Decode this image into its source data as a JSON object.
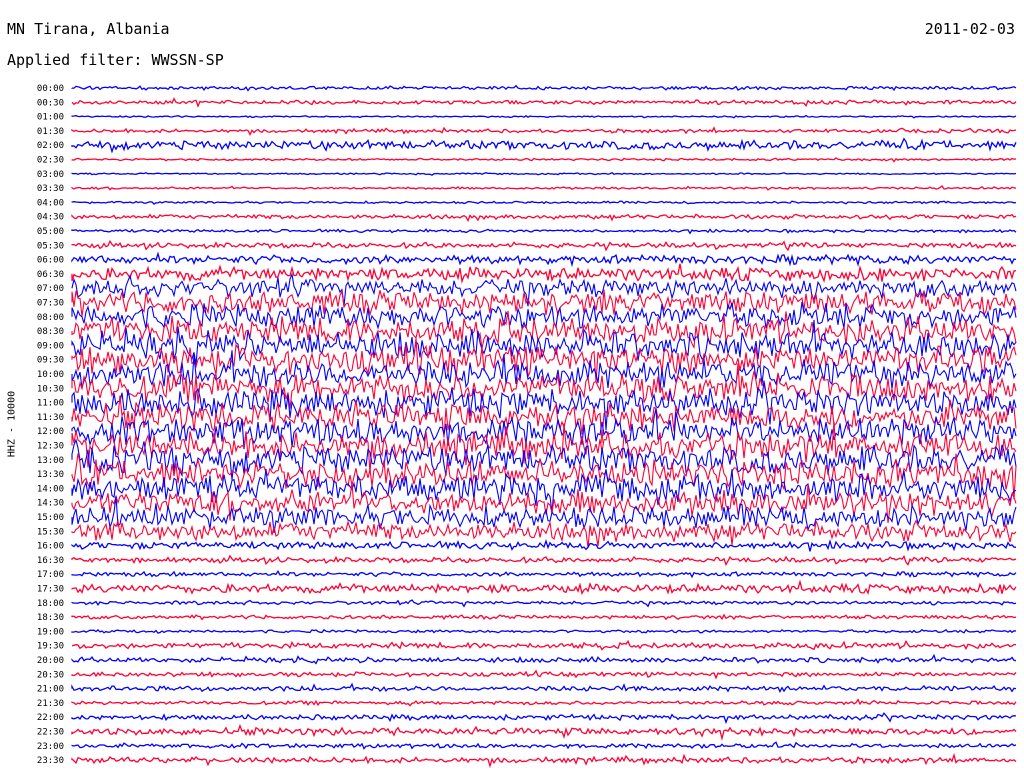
{
  "chart_data": {
    "type": "line",
    "title": "MN Tirana, Albania",
    "date": "2011-02-03",
    "subtitle": "Applied filter: WWSSN-SP",
    "ylabel": "HHZ - 10000",
    "xlabel": "",
    "row_labels": [
      "00:00",
      "00:30",
      "01:00",
      "01:30",
      "02:00",
      "02:30",
      "03:00",
      "03:30",
      "04:00",
      "04:30",
      "05:00",
      "05:30",
      "06:00",
      "06:30",
      "07:00",
      "07:30",
      "08:00",
      "08:30",
      "09:00",
      "09:30",
      "10:00",
      "10:30",
      "11:00",
      "11:30",
      "12:00",
      "12:30",
      "13:00",
      "13:30",
      "14:00",
      "14:30",
      "15:00",
      "15:30",
      "16:00",
      "16:30",
      "17:00",
      "17:30",
      "18:00",
      "18:30",
      "19:00",
      "19:30",
      "20:00",
      "20:30",
      "21:00",
      "21:30",
      "22:00",
      "22:30",
      "23:00",
      "23:30"
    ],
    "series_colors": [
      "#0000ff",
      "#ff0033"
    ],
    "trace_activity": [
      0.5,
      0.6,
      0.2,
      0.5,
      1.2,
      0.3,
      0.2,
      0.3,
      0.3,
      0.6,
      0.4,
      0.7,
      1.2,
      1.8,
      2.6,
      3.0,
      3.4,
      3.6,
      3.8,
      3.8,
      3.8,
      3.8,
      3.8,
      3.8,
      3.8,
      3.8,
      3.8,
      3.8,
      3.6,
      3.4,
      3.0,
      2.6,
      1.0,
      0.7,
      0.6,
      1.2,
      0.5,
      0.5,
      0.4,
      0.8,
      0.7,
      0.6,
      0.7,
      0.5,
      0.7,
      1.0,
      0.6,
      0.8
    ]
  }
}
